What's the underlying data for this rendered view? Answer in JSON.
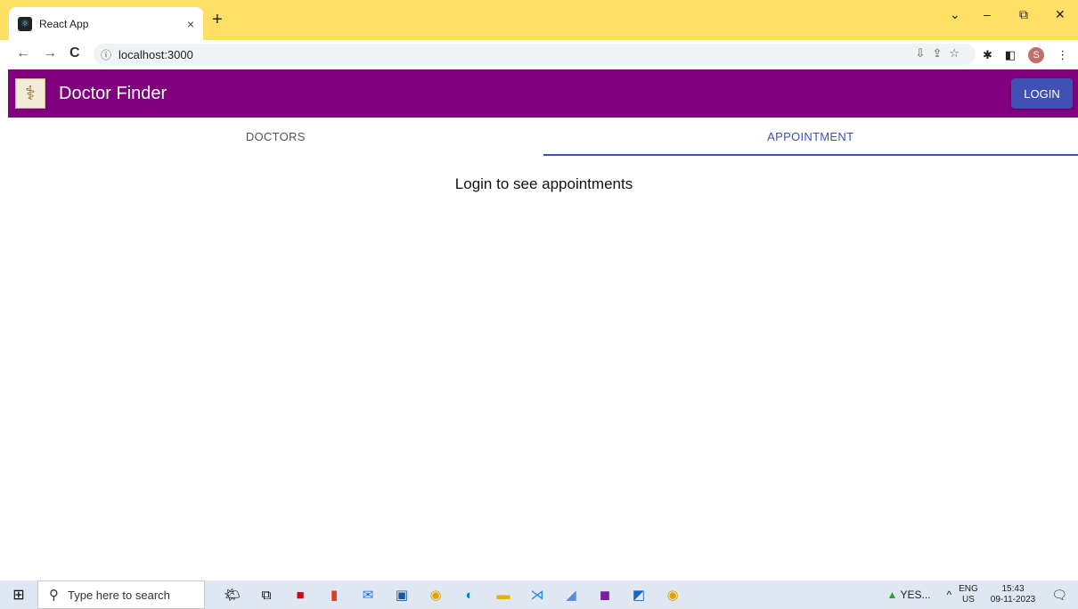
{
  "browser": {
    "tab_title": "React App",
    "tab_close": "×",
    "new_tab": "+",
    "url": "localhost:3000",
    "info_icon": "ⓘ",
    "window_controls": {
      "minimize": "–",
      "restore": "⧉",
      "close": "✕",
      "dropdown": "⌄"
    },
    "nav": {
      "back": "←",
      "forward": "→",
      "reload": "C"
    },
    "profile_initial": "S"
  },
  "app": {
    "title": "Doctor Finder",
    "login_label": "LOGIN",
    "logo_symbol": "⚕",
    "header_color": "#800080",
    "accent_color": "#3f51b5"
  },
  "tabs": [
    {
      "label": "DOCTORS",
      "active": false
    },
    {
      "label": "APPOINTMENT",
      "active": true
    }
  ],
  "main": {
    "message": "Login to see appointments"
  },
  "taskbar": {
    "search_placeholder": "Type here to search",
    "tray_item": "YES...",
    "lang_line1": "ENG",
    "lang_line2": "US",
    "time": "15:43",
    "date": "09-11-2023"
  }
}
